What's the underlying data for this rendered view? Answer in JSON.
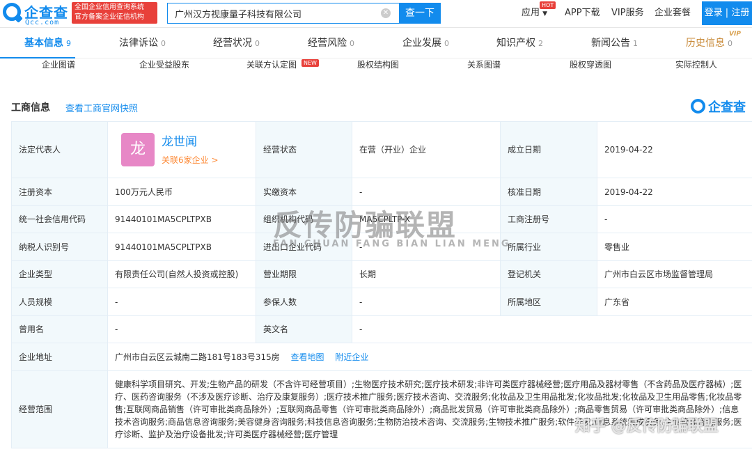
{
  "header": {
    "logo_name": "企查查",
    "logo_sub": "Qcc.com",
    "badge_line1": "全国企业信用查询系统",
    "badge_line2": "官方备案企业征信机构",
    "search_value": "广州汉方视康量子科技有限公司",
    "search_button": "查一下",
    "nav": {
      "app": "应用",
      "hot": "HOT",
      "download": "APP下载",
      "vip": "VIP服务",
      "package": "企业套餐",
      "login": "登录 | 注册"
    }
  },
  "tabs": [
    {
      "label": "基本信息",
      "count": "9"
    },
    {
      "label": "法律诉讼",
      "count": "0"
    },
    {
      "label": "经营状况",
      "count": "0"
    },
    {
      "label": "经营风险",
      "count": "0"
    },
    {
      "label": "企业发展",
      "count": "0"
    },
    {
      "label": "知识产权",
      "count": "2"
    },
    {
      "label": "新闻公告",
      "count": "1"
    },
    {
      "label": "历史信息",
      "count": "0"
    }
  ],
  "vip_tag": "VIP",
  "subnav": [
    "企业图谱",
    "企业受益股东",
    "关联方认定图",
    "股权结构图",
    "关系图谱",
    "股权穿透图",
    "实际控制人"
  ],
  "new_tag": "NEW",
  "section": {
    "title": "工商信息",
    "snapshot_link": "查看工商官网快照",
    "brand": "企查查"
  },
  "info": {
    "legal_rep_label": "法定代表人",
    "legal_rep_avatar": "龙",
    "legal_rep_name": "龙世闻",
    "legal_rep_link": "关联6家企业 >",
    "status_label": "经营状态",
    "status_value": "在营（开业）企业",
    "founded_label": "成立日期",
    "founded_value": "2019-04-22",
    "reg_capital_label": "注册资本",
    "reg_capital_value": "100万元人民币",
    "paid_capital_label": "实缴资本",
    "paid_capital_value": "-",
    "approval_label": "核准日期",
    "approval_value": "2019-04-22",
    "credit_code_label": "统一社会信用代码",
    "credit_code_value": "91440101MA5CPLTPXB",
    "org_code_label": "组织机构代码",
    "org_code_value": "MA5CPLTP-X",
    "reg_no_label": "工商注册号",
    "reg_no_value": "-",
    "taxpayer_label": "纳税人识别号",
    "taxpayer_value": "91440101MA5CPLTPXB",
    "import_label": "进出口企业代码",
    "import_value": "-",
    "industry_label": "所属行业",
    "industry_value": "零售业",
    "type_label": "企业类型",
    "type_value": "有限责任公司(自然人投资或控股)",
    "term_label": "营业期限",
    "term_value": "长期",
    "authority_label": "登记机关",
    "authority_value": "广州市白云区市场监督管理局",
    "staff_label": "人员规模",
    "staff_value": "-",
    "insured_label": "参保人数",
    "insured_value": "-",
    "region_label": "所属地区",
    "region_value": "广东省",
    "former_name_label": "曾用名",
    "former_name_value": "-",
    "english_label": "英文名",
    "english_value": "-",
    "address_label": "企业地址",
    "address_value": "广州市白云区云城南二路181号183号315房",
    "map_link": "查看地图",
    "nearby_link": "附近企业",
    "scope_label": "经营范围",
    "scope_value": "健康科学项目研究、开发;生物产品的研发（不含许可经营项目）;生物医疗技术研究;医疗技术研发;非许可类医疗器械经营;医疗用品及器材零售（不含药品及医疗器械）;医疗、医药咨询服务（不涉及医疗诊断、治疗及康复服务）;医疗技术推广服务;医疗技术咨询、交流服务;化妆品及卫生用品批发;化妆品批发;化妆品及卫生用品零售;化妆品零售;互联网商品销售（许可审批类商品除外）;互联网商品零售（许可审批类商品除外）;商品批发贸易（许可审批类商品除外）;商品零售贸易（许可审批类商品除外）;信息技术咨询服务;商品信息咨询服务;美容健身咨询服务;科技信息咨询服务;生物防治技术咨询、交流服务;生物技术推广服务;软件开发;信息系统集成服务;企业管理咨询服务;医疗诊断、监护及治疗设备批发;许可类医疗器械经营;医疗管理"
  },
  "watermarks": {
    "main": "反传防骗联盟",
    "sub": "FAN CHUAN FANG BIAN LIAN MENG",
    "corner": "知乎 @反传防骗联盟"
  }
}
